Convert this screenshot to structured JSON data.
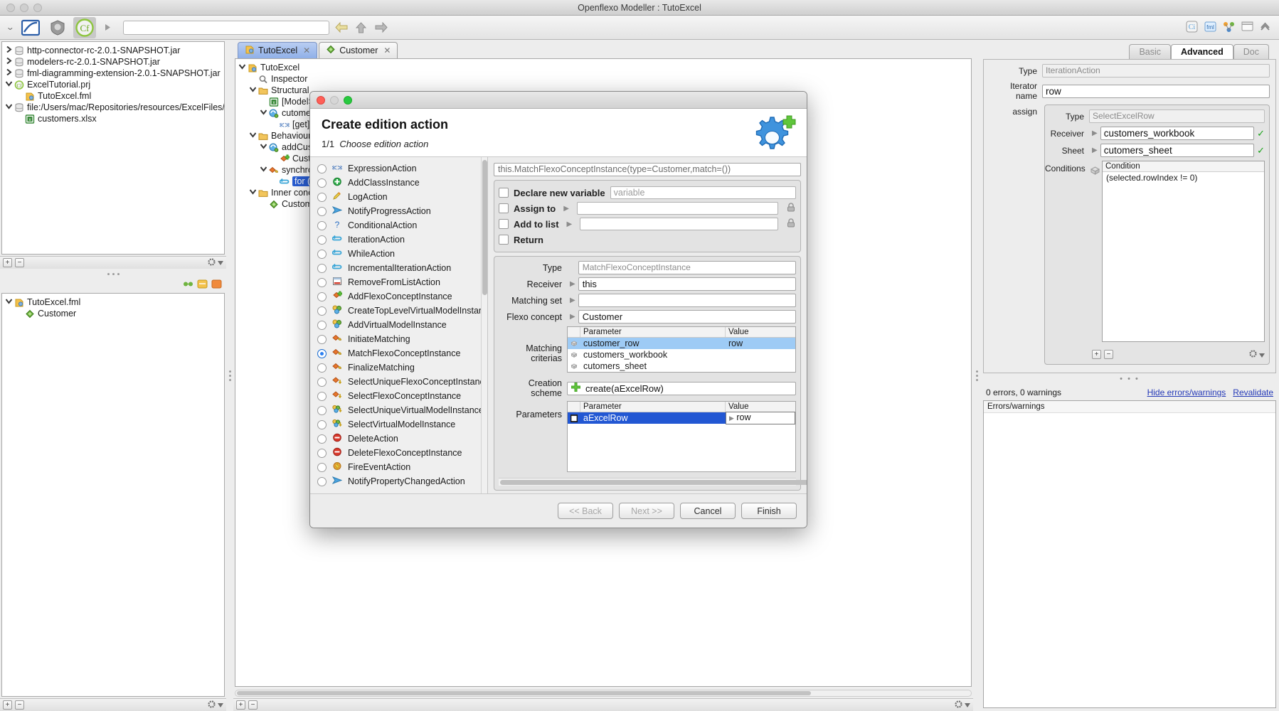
{
  "window": {
    "title": "Openflexo Modeller : TutoExcel"
  },
  "toolbar": {
    "url_value": "",
    "icons": [
      "chevrons-down-icon",
      "editor-icon",
      "shield-icon",
      "openflexo-icon",
      "play-icon",
      "back-arrow-icon",
      "up-arrow-icon",
      "forward-arrow-icon"
    ],
    "right_icons": [
      "info-icon",
      "fml-icon",
      "diagram-icon",
      "window-icon",
      "collapse-icon"
    ]
  },
  "project_browser": {
    "items": [
      {
        "label": "http-connector-rc-2.0.1-SNAPSHOT.jar",
        "icon": "jar-icon",
        "twisty": "collapsed",
        "indent": 0
      },
      {
        "label": "modelers-rc-2.0.1-SNAPSHOT.jar",
        "icon": "jar-icon",
        "twisty": "collapsed",
        "indent": 0
      },
      {
        "label": "fml-diagramming-extension-2.0.1-SNAPSHOT.jar",
        "icon": "jar-icon",
        "twisty": "collapsed",
        "indent": 0
      },
      {
        "label": "ExcelTutorial.prj",
        "icon": "project-icon",
        "twisty": "expanded",
        "indent": 0
      },
      {
        "label": "TutoExcel.fml",
        "icon": "fml-icon",
        "twisty": "none",
        "indent": 1
      },
      {
        "label": "file:/Users/mac/Repositories/resources/ExcelFiles/",
        "icon": "jar-icon",
        "twisty": "expanded",
        "indent": 0
      },
      {
        "label": "customers.xlsx",
        "icon": "excel-icon",
        "twisty": "none",
        "indent": 1
      }
    ]
  },
  "resource_browser": {
    "items": [
      {
        "label": "TutoExcel.fml",
        "icon": "fml-icon",
        "twisty": "expanded",
        "indent": 0
      },
      {
        "label": "Customer",
        "icon": "concept-icon",
        "twisty": "none",
        "indent": 1
      }
    ]
  },
  "editor_tabs": [
    {
      "label": "TutoExcel",
      "icon": "fml-icon",
      "active": true,
      "closable": true
    },
    {
      "label": "Customer",
      "icon": "concept-icon",
      "active": false,
      "closable": true
    }
  ],
  "fml_tree": {
    "items": [
      {
        "label": "TutoExcel",
        "icon": "fml-icon",
        "twisty": "expanded",
        "indent": 0,
        "selected": false
      },
      {
        "label": "Inspector",
        "icon": "inspector-icon",
        "twisty": "none",
        "indent": 1,
        "selected": false
      },
      {
        "label": "Structural",
        "icon": "folder-icon",
        "twisty": "expanded",
        "indent": 1,
        "selected": false
      },
      {
        "label": "[ModelS",
        "icon": "excel-icon",
        "twisty": "none",
        "indent": 2,
        "selected": false
      },
      {
        "label": "cutomer",
        "icon": "role-icon",
        "twisty": "expanded",
        "indent": 2,
        "selected": false
      },
      {
        "label": "[get]",
        "icon": "expr-icon",
        "twisty": "none",
        "indent": 3,
        "selected": false
      },
      {
        "label": "Behavioural",
        "icon": "folder-icon",
        "twisty": "expanded",
        "indent": 1,
        "selected": false
      },
      {
        "label": "addCus",
        "icon": "role-icon",
        "twisty": "expanded",
        "indent": 2,
        "selected": false
      },
      {
        "label": "Custo",
        "icon": "add-concept-icon",
        "twisty": "none",
        "indent": 3,
        "selected": false
      },
      {
        "label": "synchro",
        "icon": "match-icon",
        "twisty": "expanded",
        "indent": 2,
        "selected": false
      },
      {
        "label": "for (",
        "icon": "iteration-icon",
        "twisty": "none",
        "indent": 3,
        "selected": true
      },
      {
        "label": "Inner conce",
        "icon": "folder-icon",
        "twisty": "expanded",
        "indent": 1,
        "selected": false
      },
      {
        "label": "Custome",
        "icon": "concept-icon",
        "twisty": "none",
        "indent": 2,
        "selected": false
      }
    ]
  },
  "dialog": {
    "title_buttons": [
      "close",
      "minimize",
      "zoom"
    ],
    "heading": "Create edition action",
    "step": "1/1",
    "step_label": "Choose edition action",
    "gear_icon": "gear-plus-icon",
    "actions": [
      {
        "label": "ExpressionAction",
        "icon": "expr-icon",
        "selected": false
      },
      {
        "label": "AddClassInstance",
        "icon": "add-class-icon",
        "selected": false
      },
      {
        "label": "LogAction",
        "icon": "pencil-icon",
        "selected": false
      },
      {
        "label": "NotifyProgressAction",
        "icon": "notify-icon",
        "selected": false
      },
      {
        "label": "ConditionalAction",
        "icon": "question-icon",
        "selected": false
      },
      {
        "label": "IterationAction",
        "icon": "iteration-icon",
        "selected": false
      },
      {
        "label": "WhileAction",
        "icon": "iteration-icon",
        "selected": false
      },
      {
        "label": "IncrementalIterationAction",
        "icon": "iteration-icon",
        "selected": false
      },
      {
        "label": "RemoveFromListAction",
        "icon": "list-icon",
        "selected": false
      },
      {
        "label": "AddFlexoConceptInstance",
        "icon": "add-concept-icon",
        "selected": false
      },
      {
        "label": "CreateTopLevelVirtualModelInstance",
        "icon": "vm-icon",
        "selected": false
      },
      {
        "label": "AddVirtualModelInstance",
        "icon": "vm-icon",
        "selected": false
      },
      {
        "label": "InitiateMatching",
        "icon": "match-icon",
        "selected": false
      },
      {
        "label": "MatchFlexoConceptInstance",
        "icon": "match-icon",
        "selected": true
      },
      {
        "label": "FinalizeMatching",
        "icon": "match-icon",
        "selected": false
      },
      {
        "label": "SelectUniqueFlexoConceptInstance",
        "icon": "select-concept-icon",
        "selected": false
      },
      {
        "label": "SelectFlexoConceptInstance",
        "icon": "select-concept-icon",
        "selected": false
      },
      {
        "label": "SelectUniqueVirtualModelInstance",
        "icon": "select-vm-icon",
        "selected": false
      },
      {
        "label": "SelectVirtualModelInstance",
        "icon": "select-vm-icon",
        "selected": false
      },
      {
        "label": "DeleteAction",
        "icon": "delete-icon",
        "selected": false
      },
      {
        "label": "DeleteFlexoConceptInstance",
        "icon": "delete-icon",
        "selected": false
      },
      {
        "label": "FireEventAction",
        "icon": "event-icon",
        "selected": false
      },
      {
        "label": "NotifyPropertyChangedAction",
        "icon": "notify-icon",
        "selected": false
      }
    ],
    "expression": "this.MatchFlexoConceptInstance(type=Customer,match=())",
    "options": [
      {
        "label": "Declare new variable",
        "checked": false,
        "placeholder": "variable",
        "has_input": true,
        "has_arrow": false,
        "has_lock": false
      },
      {
        "label": "Assign to",
        "checked": false,
        "value": "",
        "has_input": true,
        "has_arrow": true,
        "has_lock": true
      },
      {
        "label": "Add to list",
        "checked": false,
        "value": "",
        "has_input": true,
        "has_arrow": true,
        "has_lock": true
      },
      {
        "label": "Return",
        "checked": false,
        "has_input": false,
        "has_arrow": false,
        "has_lock": false
      }
    ],
    "fields": [
      {
        "label": "Type",
        "value": "MatchFlexoConceptInstance",
        "readonly": true,
        "arrow": false
      },
      {
        "label": "Receiver",
        "value": "this",
        "readonly": false,
        "arrow": true
      },
      {
        "label": "Matching set",
        "value": "",
        "readonly": false,
        "arrow": true
      },
      {
        "label": "Flexo concept",
        "value": "Customer",
        "readonly": false,
        "arrow": true
      }
    ],
    "matching_criterias": {
      "label": "Matching criterias",
      "columns": [
        "Parameter",
        "Value"
      ],
      "rows": [
        {
          "parameter": "customer_row",
          "value": "row",
          "selected": true
        },
        {
          "parameter": "customers_workbook",
          "value": "",
          "selected": false
        },
        {
          "parameter": "cutomers_sheet",
          "value": "",
          "selected": false
        }
      ]
    },
    "creation_scheme": {
      "label": "Creation scheme",
      "value": "create(aExcelRow)",
      "icon": "plus-green-icon"
    },
    "parameters": {
      "label": "Parameters",
      "columns": [
        "Parameter",
        "Value"
      ],
      "rows": [
        {
          "parameter": "aExcelRow",
          "value": "row",
          "selected": true
        }
      ]
    },
    "buttons": [
      {
        "label": "<< Back",
        "disabled": true
      },
      {
        "label": "Next >>",
        "disabled": true
      },
      {
        "label": "Cancel",
        "disabled": false
      },
      {
        "label": "Finish",
        "disabled": false
      }
    ]
  },
  "inspector": {
    "tabs": [
      {
        "label": "Basic",
        "active": false
      },
      {
        "label": "Advanced",
        "active": true
      },
      {
        "label": "Doc",
        "active": false
      }
    ],
    "type_label": "Type",
    "type_value": "IterationAction",
    "iterator_label": "Iterator name",
    "iterator_value": "row",
    "assign_label": "assign",
    "assign": {
      "type_label": "Type",
      "type_value": "SelectExcelRow",
      "receiver_label": "Receiver",
      "receiver_value": "customers_workbook",
      "receiver_ok": true,
      "sheet_label": "Sheet",
      "sheet_value": "cutomers_sheet",
      "sheet_ok": true,
      "conditions_label": "Conditions",
      "conditions_header": "Condition",
      "conditions_rows": [
        "(selected.rowIndex != 0)"
      ]
    }
  },
  "status": {
    "errors_text": "0 errors, 0 warnings",
    "hide_link": "Hide errors/warnings",
    "revalidate_link": "Revalidate",
    "errors_panel_title": "Errors/warnings"
  }
}
